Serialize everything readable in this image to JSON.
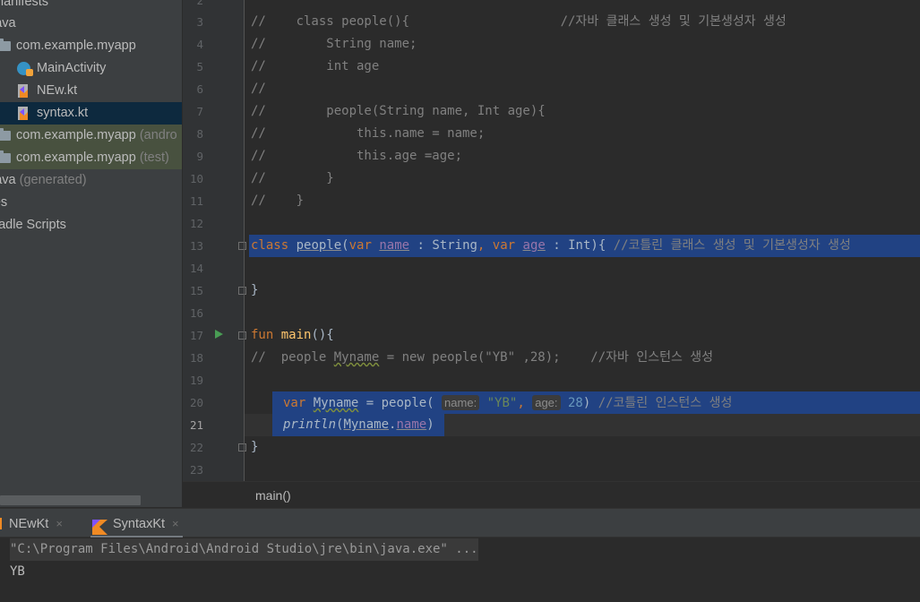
{
  "project_tree": [
    {
      "label": "manifests",
      "indent": 0
    },
    {
      "label": "java",
      "indent": 0
    },
    {
      "label": "com.example.myapp",
      "indent": 1,
      "icon": "package-icon"
    },
    {
      "label": "MainActivity",
      "indent": 2,
      "icon": "kotlin-class-icon"
    },
    {
      "label": "NEw.kt",
      "indent": 2,
      "icon": "kotlin-file-icon"
    },
    {
      "label": "syntax.kt",
      "indent": 2,
      "icon": "kotlin-file-icon",
      "selected": true
    },
    {
      "label": "com.example.myapp",
      "suffix": "(andro",
      "indent": 1,
      "icon": "package-icon"
    },
    {
      "label": "com.example.myapp",
      "suffix": "(test)",
      "indent": 1,
      "icon": "package-icon"
    },
    {
      "label": "java",
      "suffix": "(generated)",
      "indent": 0
    },
    {
      "label": "res",
      "indent": 0
    },
    {
      "label": "Gradle Scripts",
      "indent": 0
    }
  ],
  "editor": {
    "line_numbers": [
      "2",
      "3",
      "4",
      "5",
      "6",
      "7",
      "8",
      "9",
      "10",
      "11",
      "12",
      "13",
      "14",
      "15",
      "16",
      "17",
      "18",
      "19",
      "20",
      "21",
      "22",
      "23"
    ],
    "current_line": "21",
    "lines": {
      "l3": {
        "cm": "//    class people(){                    //자바 클래스 생성 및 기본생성자 생성"
      },
      "l4": {
        "cm": "//        String name;"
      },
      "l5": {
        "cm": "//        int age"
      },
      "l6": {
        "cm": "//"
      },
      "l7": {
        "cm": "//        people(String name, Int age){"
      },
      "l8": {
        "cm": "//            this.name = name;"
      },
      "l9": {
        "cm": "//            this.age =age;"
      },
      "l10": {
        "cm": "//        }"
      },
      "l11": {
        "cm": "//    }"
      },
      "l13": {
        "kw_class": "class",
        "cls": "people",
        "p1": "(",
        "kw_var1": "var",
        "name": "name",
        "t1": " : String",
        "comma": ",",
        "kw_var2": "var",
        "age": "age",
        "t2": " : Int){",
        "cm": " //코틀린 클래스 생성 및 기본생성자 생성"
      },
      "l15": {
        "text": "}"
      },
      "l17": {
        "kw_fun": "fun",
        "fn": "main",
        "rest": "(){"
      },
      "l18": {
        "c1": "//  people ",
        "c2": "Myname",
        "c3": " = new people(\"YB\" ,28);    //자바 인스턴스 생성"
      },
      "l20": {
        "kw_var": "var",
        "var": "Myname",
        "eq": " = people(",
        "hint_name": "name:",
        "str": "\"YB\"",
        "comma": ",",
        "hint_age": "age:",
        "num": "28",
        "close": ")",
        "cm": " //코틀린 인스턴스 생성"
      },
      "l21": {
        "fn": "println",
        "p1": "(",
        "var": "Myname",
        "dot": ".",
        "prop": "name",
        "p2": ")"
      },
      "l22": {
        "text": "}"
      }
    }
  },
  "breadcrumb": "main()",
  "run_tabs": [
    {
      "label": "NEwKt",
      "close": "×"
    },
    {
      "label": "SyntaxKt",
      "close": "×",
      "active": true
    }
  ],
  "console": {
    "command": "\"C:\\Program Files\\Android\\Android Studio\\jre\\bin\\java.exe\" ...",
    "output": "YB"
  },
  "colors": {
    "keyword": "#cc7832",
    "function": "#ffc66d",
    "string": "#6a8759",
    "number": "#6897bb",
    "property": "#9876aa",
    "comment": "#808080",
    "selection": "#214283"
  }
}
